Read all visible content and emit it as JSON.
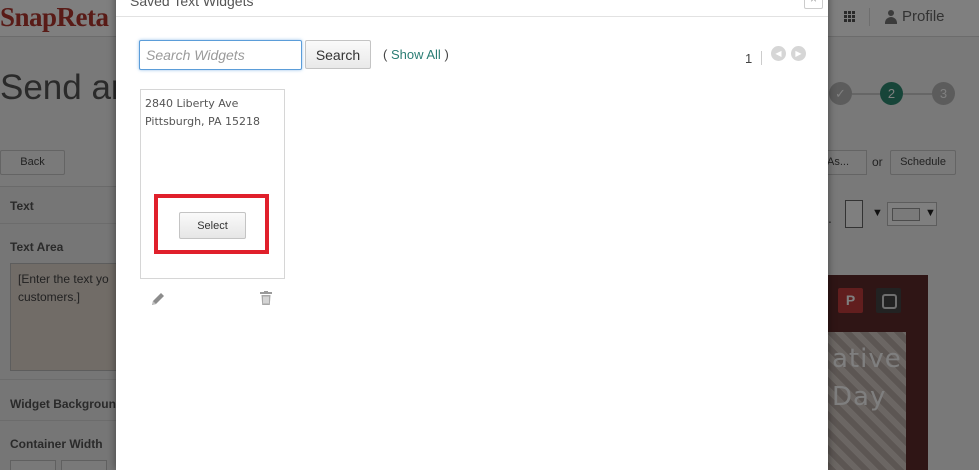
{
  "app": {
    "logo": "SnapReta",
    "profile_label": "Profile"
  },
  "page": {
    "heading": "Send an",
    "steps": [
      "✓",
      "2",
      "3"
    ]
  },
  "toolbar": {
    "back_label": "Back",
    "save_as_label": "As...",
    "or_label": "or",
    "schedule_label": "Schedule"
  },
  "left_panel": {
    "text_label": "Text",
    "text_area_label": "Text Area",
    "text_area_value_line1": "[Enter the text yo",
    "text_area_value_line2": "customers.]",
    "widget_background_label": "Widget Background",
    "container_width_label": "Container Width"
  },
  "preview": {
    "social_p": "P",
    "line1": "ative",
    "line2": "Day"
  },
  "modal": {
    "title": "Saved Text Widgets",
    "close_label": "×",
    "search_placeholder": "Search Widgets",
    "search_button_label": "Search",
    "show_all_open": "( ",
    "show_all_label": "Show All",
    "show_all_close": " )",
    "page_number": "1",
    "prev_icon": "◀",
    "next_icon": "▶",
    "widgets": [
      {
        "line1": "2840 Liberty Ave",
        "line2": "Pittsburgh, PA 15218",
        "select_label": "Select"
      }
    ]
  },
  "colors": {
    "accent": "#2a7d74",
    "highlight": "#e0202b",
    "logo": "#b3372e",
    "step_current": "#2e8b73"
  },
  "icons": [
    "grid-icon",
    "person-icon",
    "close-icon",
    "chevron-left-icon",
    "chevron-right-icon",
    "pencil-icon",
    "trash-icon",
    "pinterest-icon",
    "instagram-icon"
  ]
}
